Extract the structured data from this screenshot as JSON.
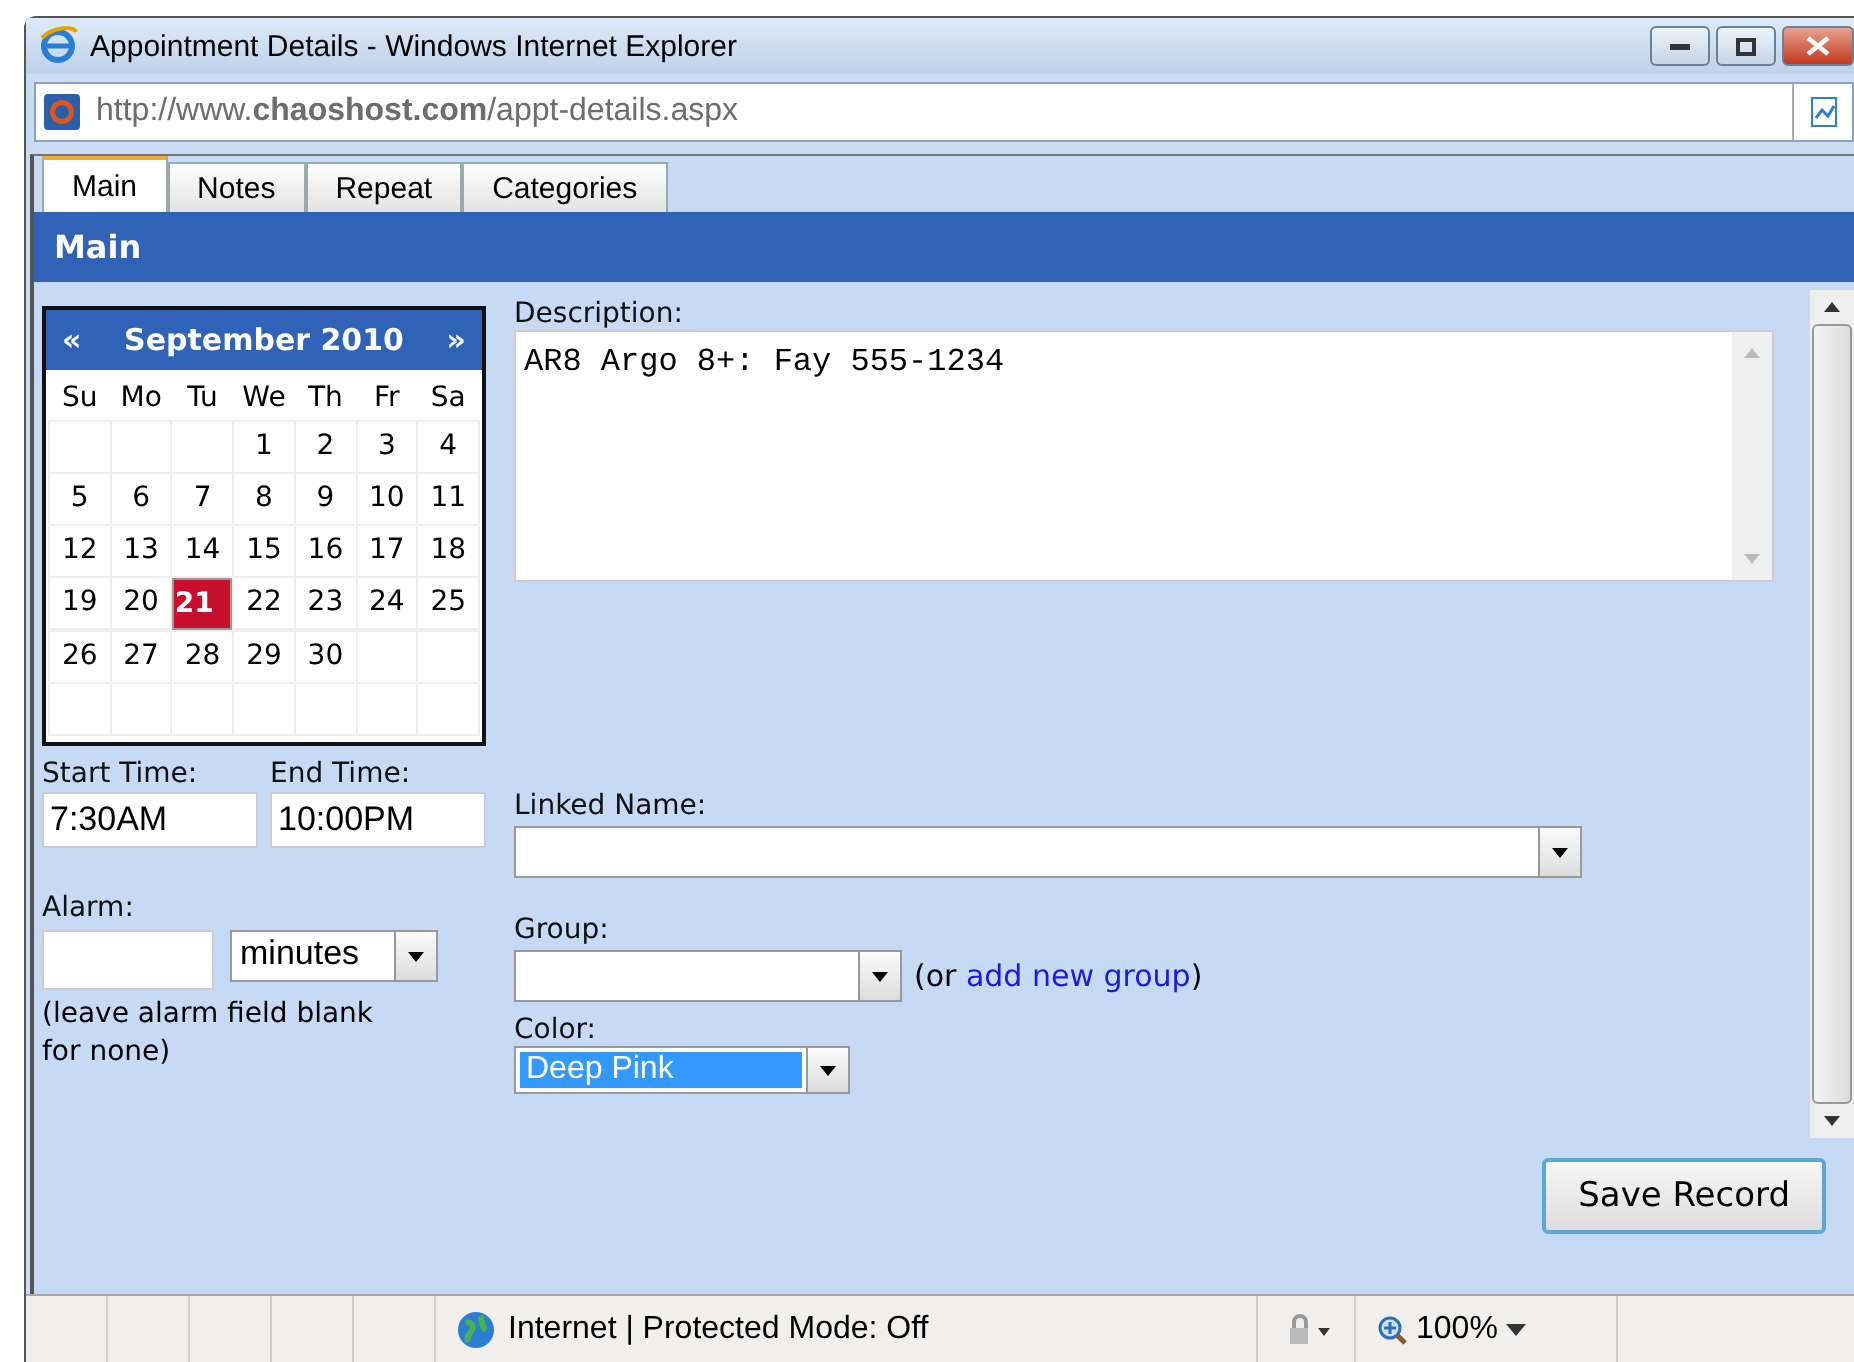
{
  "window": {
    "title": "Appointment Details - Windows Internet Explorer"
  },
  "address_bar": {
    "url": "http://www.**chaoshost.com**/appt-details.aspx"
  },
  "tabs": [
    {
      "label": "Main",
      "selected": true
    },
    {
      "label": "Notes",
      "selected": false
    },
    {
      "label": "Repeat",
      "selected": false
    },
    {
      "label": "Categories",
      "selected": false
    }
  ],
  "section_header": "Main",
  "calendar": {
    "prev": "«",
    "title": "September 2010",
    "next": "»",
    "weekdays": [
      "Su",
      "Mo",
      "Tu",
      "We",
      "Th",
      "Fr",
      "Sa"
    ],
    "weeks": [
      [
        {
          "kind": "blank"
        },
        {
          "kind": "blank"
        },
        {
          "kind": "blank"
        },
        {
          "kind": "day",
          "label": "1",
          "selected": false
        },
        {
          "kind": "day",
          "label": "2",
          "selected": false
        },
        {
          "kind": "day",
          "label": "3",
          "selected": false
        },
        {
          "kind": "day",
          "label": "4",
          "selected": false
        }
      ],
      [
        {
          "kind": "day",
          "label": "5",
          "selected": false
        },
        {
          "kind": "day",
          "label": "6",
          "selected": false
        },
        {
          "kind": "day",
          "label": "7",
          "selected": false
        },
        {
          "kind": "day",
          "label": "8",
          "selected": false
        },
        {
          "kind": "day",
          "label": "9",
          "selected": false
        },
        {
          "kind": "day",
          "label": "10",
          "selected": false
        },
        {
          "kind": "day",
          "label": "11",
          "selected": false
        }
      ],
      [
        {
          "kind": "day",
          "label": "12",
          "selected": false
        },
        {
          "kind": "day",
          "label": "13",
          "selected": false
        },
        {
          "kind": "day",
          "label": "14",
          "selected": false
        },
        {
          "kind": "day",
          "label": "15",
          "selected": false
        },
        {
          "kind": "day",
          "label": "16",
          "selected": false
        },
        {
          "kind": "day",
          "label": "17",
          "selected": false
        },
        {
          "kind": "day",
          "label": "18",
          "selected": false
        }
      ],
      [
        {
          "kind": "day",
          "label": "19",
          "selected": false
        },
        {
          "kind": "day",
          "label": "20",
          "selected": false
        },
        {
          "kind": "day",
          "label": "21",
          "selected": true
        },
        {
          "kind": "day",
          "label": "22",
          "selected": false
        },
        {
          "kind": "day",
          "label": "23",
          "selected": false
        },
        {
          "kind": "day",
          "label": "24",
          "selected": false
        },
        {
          "kind": "day",
          "label": "25",
          "selected": false
        }
      ],
      [
        {
          "kind": "day",
          "label": "26",
          "selected": false
        },
        {
          "kind": "day",
          "label": "27",
          "selected": false
        },
        {
          "kind": "day",
          "label": "28",
          "selected": false
        },
        {
          "kind": "day",
          "label": "29",
          "selected": false
        },
        {
          "kind": "day",
          "label": "30",
          "selected": false
        },
        {
          "kind": "blank"
        },
        {
          "kind": "blank"
        }
      ],
      [
        {
          "kind": "blank"
        },
        {
          "kind": "blank"
        },
        {
          "kind": "blank"
        },
        {
          "kind": "blank"
        },
        {
          "kind": "blank"
        },
        {
          "kind": "blank"
        },
        {
          "kind": "blank"
        }
      ]
    ]
  },
  "start_time": {
    "label": "Start Time:",
    "value": "7:30AM"
  },
  "end_time": {
    "label": "End Time:",
    "value": "10:00PM"
  },
  "alarm": {
    "label": "Alarm:",
    "unit": "minutes",
    "hint": "(leave alarm field blank for none)"
  },
  "description": {
    "label": "Description:",
    "value": "AR8 Argo 8+: Fay 555-1234"
  },
  "linked_name": {
    "label": "Linked Name:"
  },
  "group": {
    "label": "Group:",
    "hint_before": "(or ",
    "link": "add new group",
    "hint_after": ")"
  },
  "color": {
    "label": "Color:",
    "value": "Deep Pink"
  },
  "save_button": "Save Record",
  "status_bar": {
    "zone": "Internet | Protected Mode: Off",
    "zoom": "100%"
  }
}
